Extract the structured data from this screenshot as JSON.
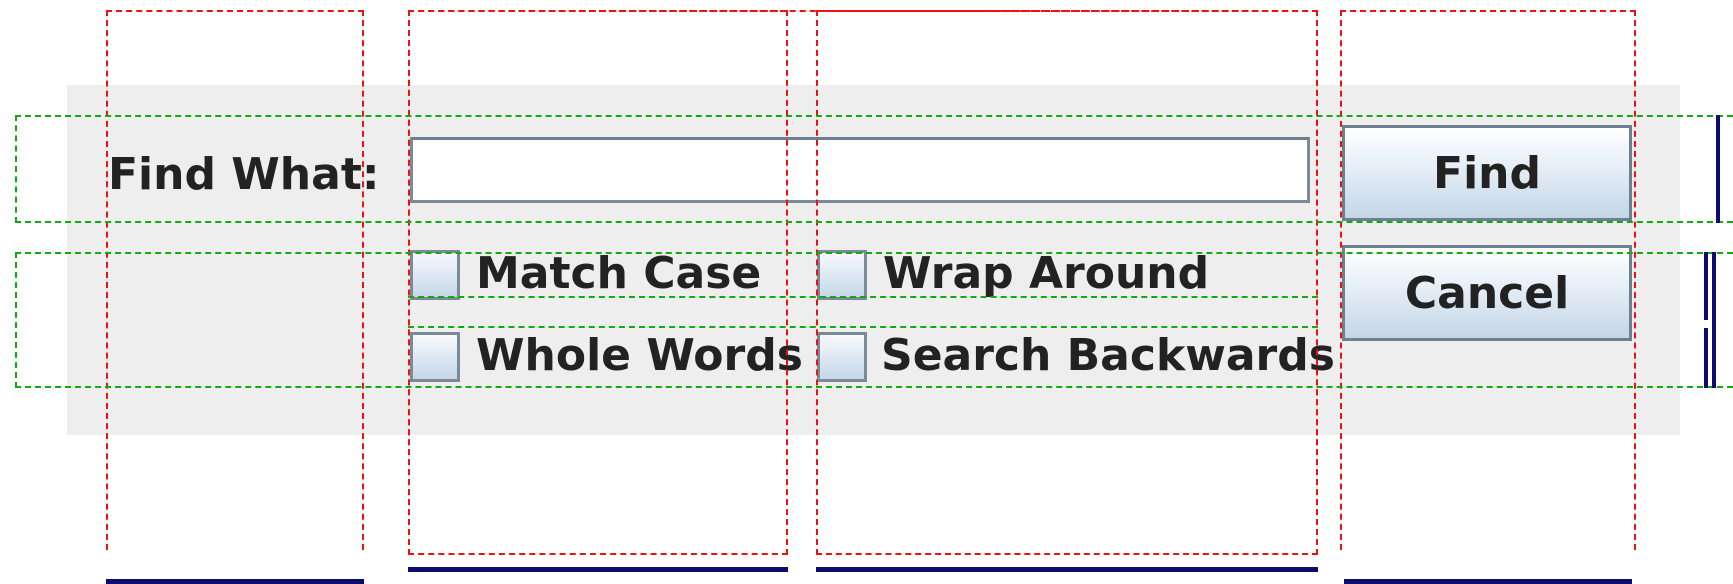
{
  "dialog": {
    "find_label": "Find What:",
    "search_input": {
      "value": "",
      "placeholder": ""
    },
    "checkboxes": [
      {
        "label": "Match Case",
        "checked": false
      },
      {
        "label": "Wrap Around",
        "checked": false
      },
      {
        "label": "Whole Words",
        "checked": false
      },
      {
        "label": "Search Backwards",
        "checked": false
      }
    ],
    "find_button": "Find",
    "cancel_button": "Cancel"
  },
  "colors": {
    "panel_background": "#eeeeee",
    "column_guide": "#ee1111",
    "row_guide": "#11aa11",
    "size_bar": "#0c0c70"
  }
}
